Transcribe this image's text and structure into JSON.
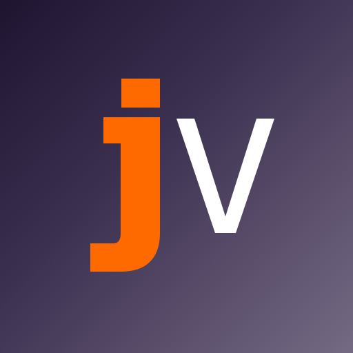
{
  "logo": {
    "letters": "jv",
    "letter_j": "j",
    "letter_v": "v"
  },
  "colors": {
    "background_top_left": "#1f1430",
    "background_bottom_right": "#746a83",
    "j_color": "#ff6a00",
    "v_color": "#ffffff"
  }
}
